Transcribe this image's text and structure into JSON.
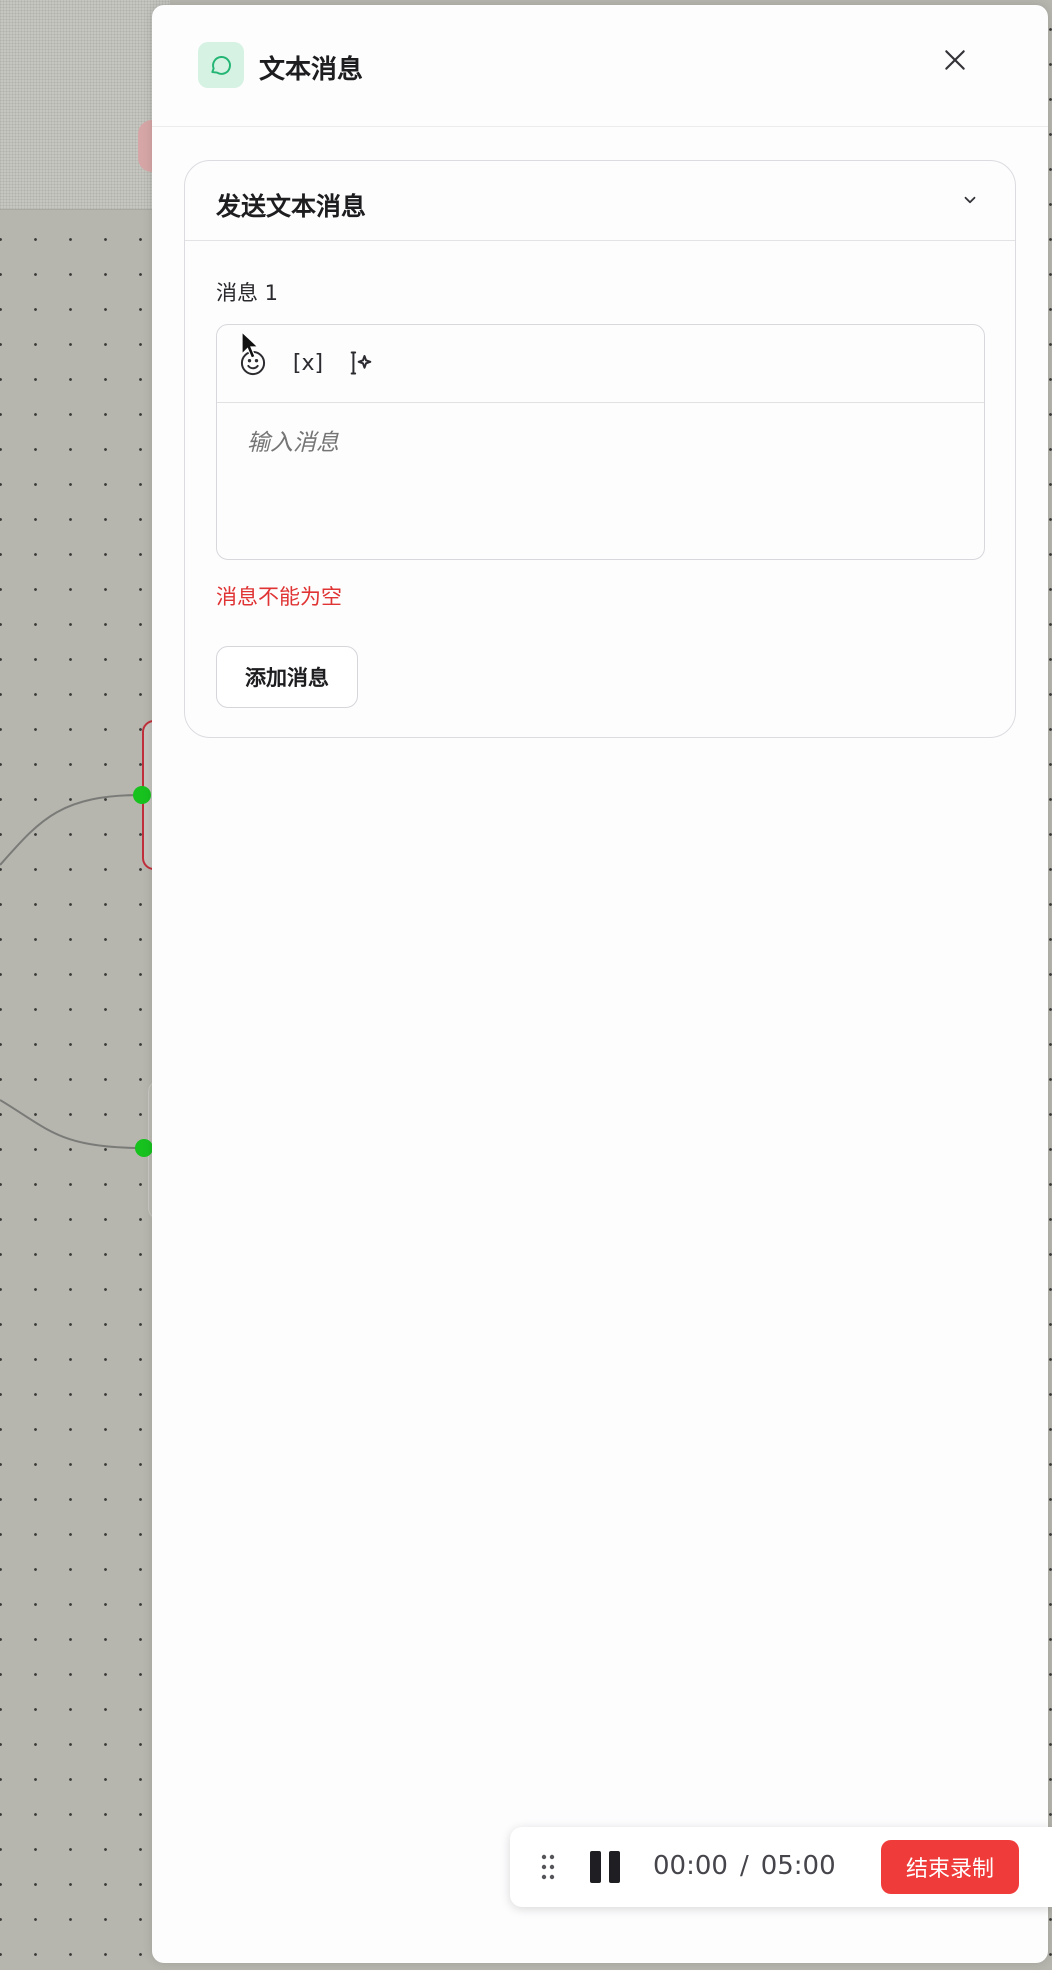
{
  "panel": {
    "title": "文本消息",
    "icon": "chat-bubble-icon",
    "accent_color": "#22b573"
  },
  "card": {
    "title": "发送文本消息",
    "message_label": "消息 1",
    "toolbar": {
      "emoji_icon": "emoji-icon",
      "variable_label": "[x]",
      "ai_icon": "ai-sparkle-icon"
    },
    "input_placeholder": "输入消息",
    "error_text": "消息不能为空",
    "add_button_label": "添加消息",
    "error_color": "#e03434"
  },
  "recording": {
    "elapsed": "00:00",
    "separator": "/",
    "limit": "05:00",
    "end_button_label": "结束录制",
    "end_button_color": "#f03b3b"
  }
}
